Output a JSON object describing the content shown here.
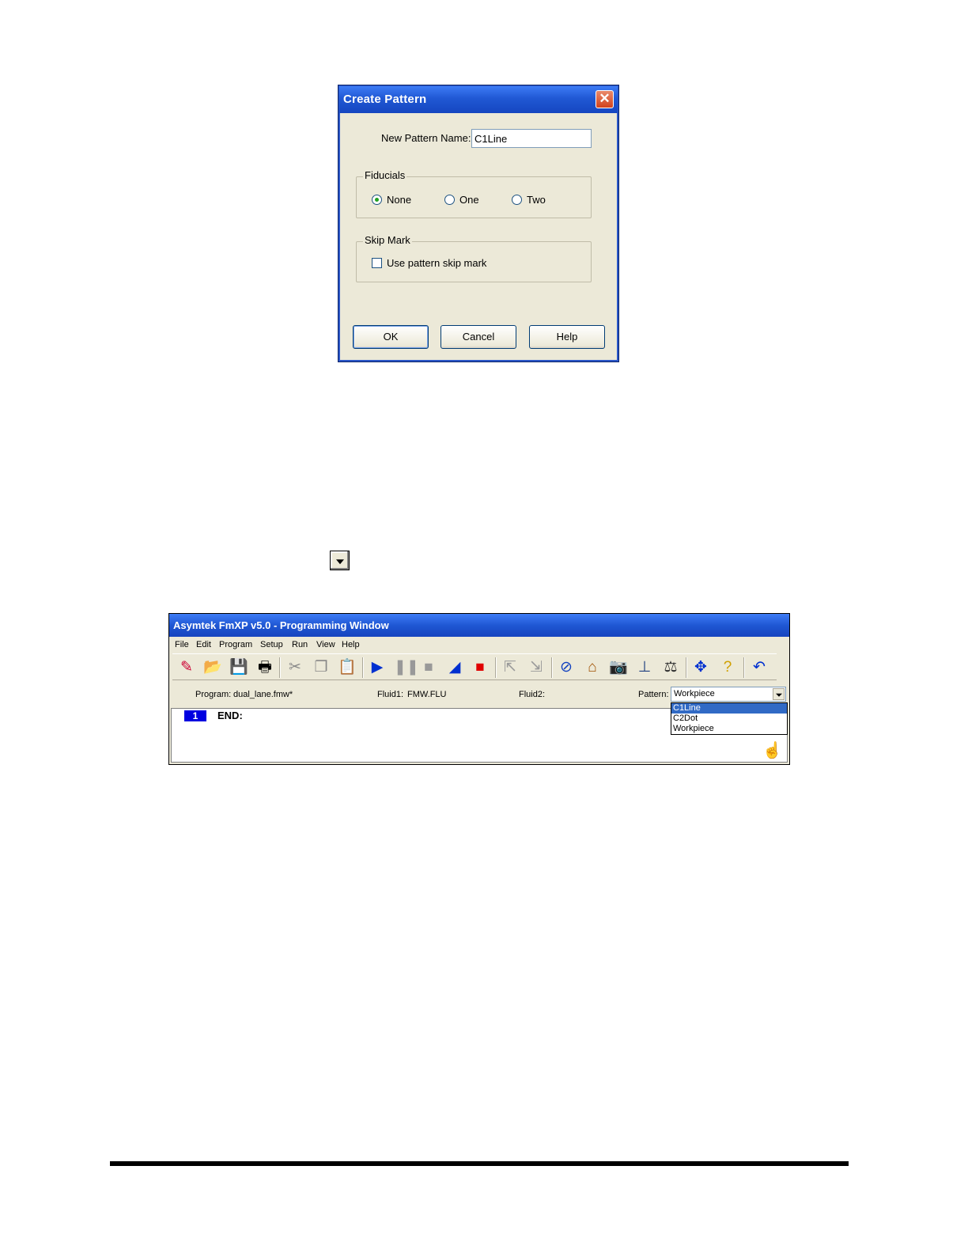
{
  "dialog": {
    "title": "Create Pattern",
    "close_glyph": "✕",
    "name_label": "New Pattern Name:",
    "name_value": "C1Line",
    "fiducials": {
      "legend": "Fiducials",
      "options": [
        "None",
        "One",
        "Two"
      ],
      "selected": "None"
    },
    "skip_mark": {
      "legend": "Skip Mark",
      "checkbox_label": "Use pattern skip mark",
      "checked": false
    },
    "buttons": {
      "ok": "OK",
      "cancel": "Cancel",
      "help": "Help"
    }
  },
  "programming_window": {
    "title": "Asymtek FmXP v5.0 - Programming Window",
    "menu": [
      "File",
      "Edit",
      "Program",
      "Setup",
      "Run",
      "View",
      "Help"
    ],
    "toolbar_icons": [
      "wizard-icon",
      "open-folder-icon",
      "save-icon",
      "print-icon",
      "cut-icon",
      "copy-icon",
      "paste-icon",
      "run-icon",
      "pause-icon",
      "stop-icon",
      "step-icon",
      "abort-icon",
      "insert-above-icon",
      "insert-below-icon",
      "fluid-icon",
      "home-icon",
      "camera-icon",
      "needle-icon",
      "scale-icon",
      "move-arrows-icon",
      "help-icon",
      "undo-icon"
    ],
    "info": {
      "program_label": "Program:",
      "program_value": "dual_lane.fmw*",
      "fluid1_label": "Fluid1:",
      "fluid1_value": "FMW.FLU",
      "fluid2_label": "Fluid2:",
      "fluid2_value": "",
      "pattern_label": "Pattern:",
      "pattern_value": "Workpiece"
    },
    "pattern_options": [
      "C1Line",
      "C2Dot",
      "Workpiece"
    ],
    "pattern_highlighted": "C1Line",
    "editor": {
      "line_number": "1",
      "command": "END:"
    }
  }
}
